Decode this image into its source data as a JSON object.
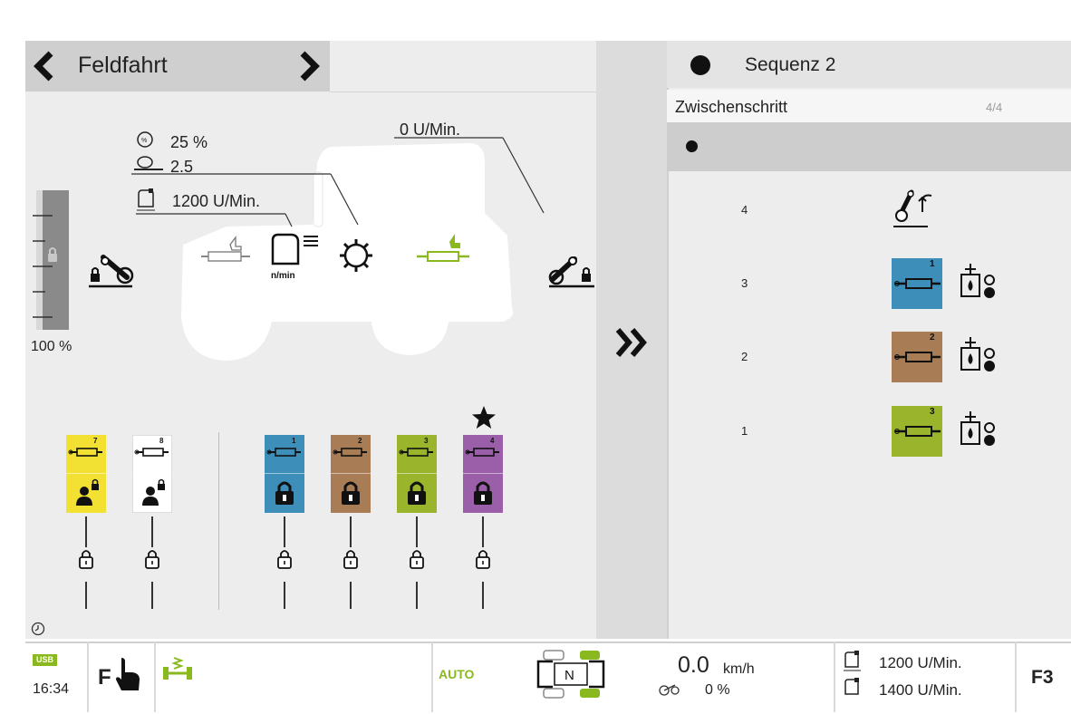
{
  "header": {
    "title": "Feldfahrt"
  },
  "tractor": {
    "pto_speed": "0 U/Min.",
    "eco_percent": "25 %",
    "ratio_value": "2.5",
    "engine_speed": "1200 U/Min.",
    "engine_icon_label": "n/min"
  },
  "left_gauge": {
    "percent": "100 %",
    "level": 1.0
  },
  "valves_left": [
    {
      "number": "7",
      "color": "#f2e033"
    },
    {
      "number": "8",
      "color": "#ffffff"
    }
  ],
  "valves_right": [
    {
      "number": "1",
      "color": "#3d8eb9"
    },
    {
      "number": "2",
      "color": "#a87d56"
    },
    {
      "number": "3",
      "color": "#9ab52b"
    },
    {
      "number": "4",
      "color": "#9b5ea8"
    }
  ],
  "sequence": {
    "title": "Sequenz 2",
    "step_label": "Zwischenschritt",
    "step_count": "4/4",
    "steps": [
      {
        "index": "4",
        "kind": "hitch"
      },
      {
        "index": "3",
        "kind": "valve",
        "valve_number": "1",
        "color": "#3d8eb9"
      },
      {
        "index": "2",
        "kind": "valve",
        "valve_number": "2",
        "color": "#a87d56"
      },
      {
        "index": "1",
        "kind": "valve",
        "valve_number": "3",
        "color": "#9ab52b"
      }
    ]
  },
  "status_bar": {
    "usb_label": "USB",
    "time": "16:34",
    "f_label": "F",
    "auto_label": "AUTO",
    "gear": "N",
    "speed": "0.0",
    "speed_unit": "km/h",
    "slip": "0 %",
    "rpm_target": "1200 U/Min.",
    "rpm_actual": "1400 U/Min.",
    "function_key": "F3"
  },
  "colors": {
    "accent_green": "#8ab81f",
    "dark": "#222222"
  }
}
